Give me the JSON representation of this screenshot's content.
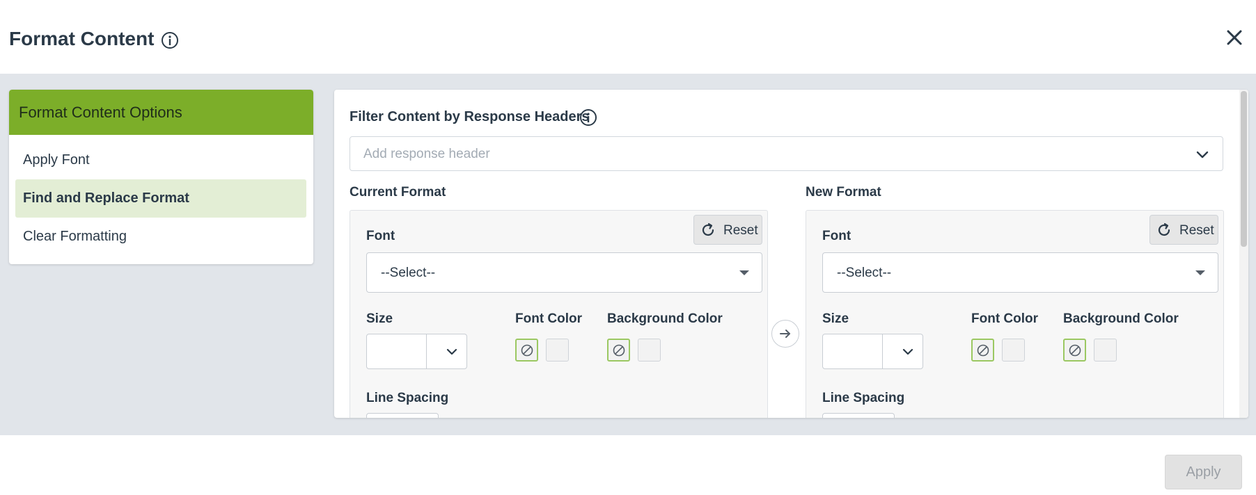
{
  "dialog": {
    "title": "Format Content"
  },
  "sidebar": {
    "header": "Format Content Options",
    "items": [
      {
        "label": "Apply Font",
        "active": false
      },
      {
        "label": "Find and Replace Format",
        "active": true
      },
      {
        "label": "Clear Formatting",
        "active": false
      }
    ]
  },
  "filter": {
    "label": "Filter Content by Response Headers",
    "placeholder": "Add response header"
  },
  "current_format": {
    "title": "Current Format",
    "reset_label": "Reset",
    "font_label": "Font",
    "font_value": "--Select--",
    "size_label": "Size",
    "size_value": "",
    "font_color_label": "Font Color",
    "background_color_label": "Background Color",
    "line_spacing_label": "Line Spacing"
  },
  "new_format": {
    "title": "New Format",
    "reset_label": "Reset",
    "font_label": "Font",
    "font_value": "--Select--",
    "size_label": "Size",
    "size_value": "",
    "font_color_label": "Font Color",
    "background_color_label": "Background Color",
    "line_spacing_label": "Line Spacing"
  },
  "footer": {
    "apply_label": "Apply"
  },
  "colors": {
    "accent": "#7cae29",
    "active_item_bg": "#e3eed5",
    "swatch_selected_border": "#9bc862",
    "text": "#2b3a48"
  },
  "icons": {
    "title_info": "info-icon",
    "close": "close-icon",
    "filter_chevron": "chevron-down-icon",
    "reset": "refresh-icon",
    "transfer": "arrow-right-icon",
    "no_color": "no-color-icon"
  }
}
